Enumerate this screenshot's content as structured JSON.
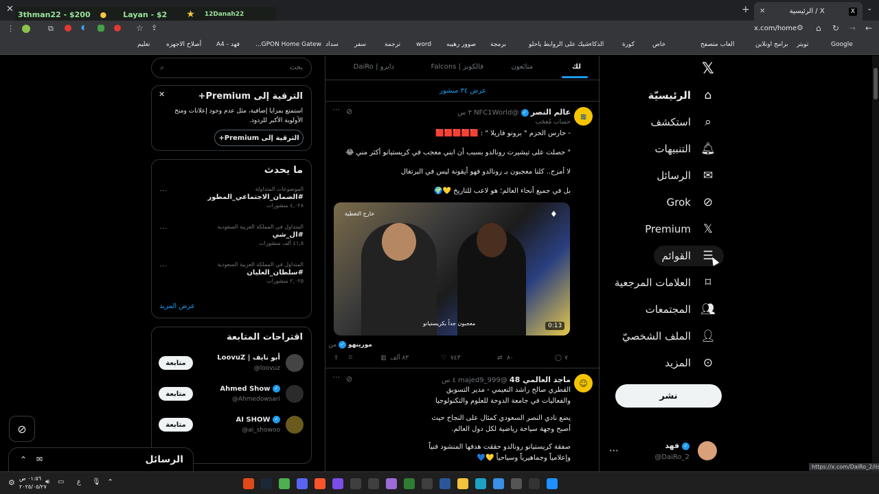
{
  "browser": {
    "tab_title": "الرئيسية / X",
    "url": "x.com/home",
    "status_url": "https://x.com/DaiRo_2/lists",
    "overlay": {
      "item1": "3thman22 - $200",
      "item2": "Layan - $2",
      "item3": "12Danah22"
    },
    "bookmarks": [
      "Google",
      "تويتر",
      "برامج اونلاين",
      "العاب متصفح",
      "خاص",
      "كورة",
      "الذكاء",
      "شيك على الروابط ياحلو",
      "برمجة",
      "صوور رهيبه",
      "word",
      "ترجمة",
      "سفر",
      "سداد",
      "GPON Home Gatew...",
      "فهد - A4",
      "أصلاح الاجهزه",
      "تعليم"
    ]
  },
  "nav": {
    "items": [
      {
        "label": "الرئيسيّة",
        "icon": "home-icon"
      },
      {
        "label": "استكشف",
        "icon": "search-icon"
      },
      {
        "label": "التنبيهات",
        "icon": "bell-icon"
      },
      {
        "label": "الرسائل",
        "icon": "mail-icon"
      },
      {
        "label": "Grok",
        "icon": "grok-icon"
      },
      {
        "label": "Premium",
        "icon": "x-logo-icon"
      },
      {
        "label": "القوائم",
        "icon": "list-icon"
      },
      {
        "label": "العلامات المرجعية",
        "icon": "bookmark-icon"
      },
      {
        "label": "المجتمعات",
        "icon": "communities-icon"
      },
      {
        "label": "الملف الشخصيّ",
        "icon": "profile-icon"
      },
      {
        "label": "المزيد",
        "icon": "more-icon"
      }
    ],
    "post_button": "نشر",
    "account": {
      "name": "فهد",
      "handle": "@DaiRo_2"
    }
  },
  "tabs": [
    "لك",
    "متابَعون",
    "فالكونز | Falcons",
    "دايرو | DaiRo"
  ],
  "show_posts": "عرض ٣٤ منشور",
  "tweet1": {
    "name": "عالم النصر",
    "handle": "@NFC1World",
    "time": "٣ س",
    "badge": "حساب مُعجَب",
    "line1": "- حارس الحزم \" برونو فاريلا \" :",
    "line2": "\" حصلت على تيشيرت رونالدو بسبب أن ابني معجب في كريستيانو أكثر مني 😂",
    "line3": "لا أمزح.. كلنا معجبون بـ رونالدو فهو أيقونة ليس في البرتغال",
    "line4": "بل في جميع أنحاء العالم؛ هو لاعب للتاريخ 💛🌍",
    "video_tag": "خارج التغطية",
    "video_caption": "معجبون جداً بكريستيانو",
    "duration": "0:13",
    "from_label": "من",
    "from_account": "مورينهو",
    "replies": "٧",
    "retweets": "٨٠",
    "likes": "٧٤٣",
    "views": "٨٣ ألف"
  },
  "tweet2": {
    "name": "ماجد العالمي 48",
    "handle": "@majed9_999",
    "time": "٤ س",
    "line1": "القطري صالح راشد النعيمي - مدير التسويق",
    "line2": "والفعاليات في جامعة الدوحة للعلوم والتكنولوجيا",
    "line3": "يضع نادي النصر السعودي كمثال على النجاح حيث",
    "line4": "أصبح وجهة سياحة رياضية لكل دول العالم.",
    "line5": "صفقة كريستيانو رونالدو حققت هدفها المنشود فنياً",
    "line6": "وإعلامياً وجماهيرياً وسياحياً 💛💙"
  },
  "search": {
    "placeholder": "بحث"
  },
  "premium": {
    "title": "الترقية إلى Premium+",
    "body1": "استمتع بمزايا إضافية، مثل عدم وجود إعلانات ومنح",
    "body2": "الأولوية الأكبر للردود.",
    "button": "الترقية إلى Premium+"
  },
  "trending": {
    "title": "ما يحدث",
    "items": [
      {
        "context": "الموضوعات المتداولة",
        "tag": "#الضمان_الاجتماعي_المطور",
        "count": "٤,٠٢٨ منشورات"
      },
      {
        "context": "المتداول في المملكة العربية السعودية",
        "tag": "#ال_شي",
        "count": "٤١,٥ ألف منشورات"
      },
      {
        "context": "المتداول في المملكة العربية السعودية",
        "tag": "#سلطان_العليان",
        "count": "٢,٠٢٥ منشورات"
      }
    ],
    "show_more": "عرض المزيد"
  },
  "follow": {
    "title": "اقتراحات المتابعة",
    "button": "متابعة",
    "users": [
      {
        "name": "أبو نايف | LoovuZ",
        "handle": "@loovuz"
      },
      {
        "name": "Ahmed Show",
        "handle": "@Ahmedowsari"
      },
      {
        "name": "AI SHOW",
        "handle": "@ai_showoo"
      }
    ]
  },
  "messages_drawer": "الرسائل",
  "taskbar": {
    "time": "٠١:٥٦ ص",
    "date": "٢٠٢٥/٠٥/٢٧",
    "lang": "ع"
  }
}
